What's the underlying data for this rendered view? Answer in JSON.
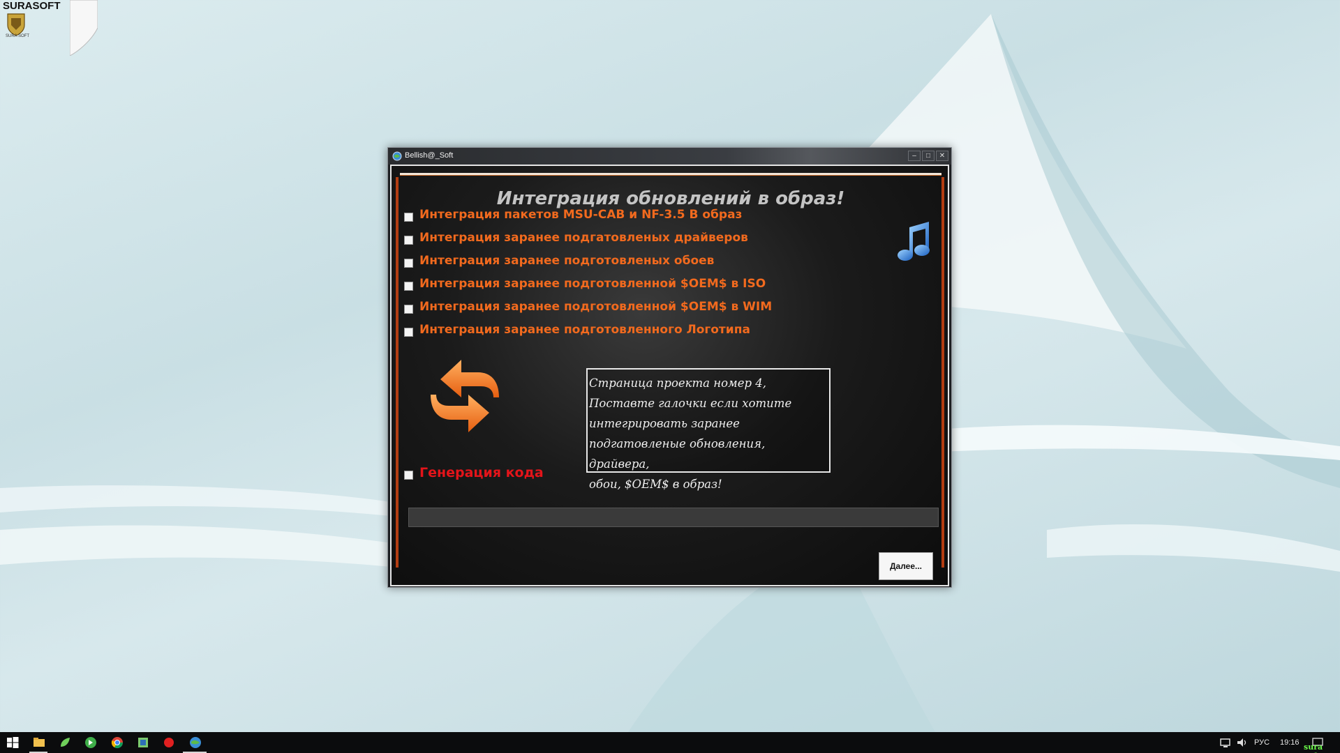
{
  "desktop": {
    "corner_brand": "SURASOFT",
    "corner_crest_caption": "SURA SOFT"
  },
  "window": {
    "title": "Bellish@_Soft",
    "controls": {
      "minimize": "–",
      "maximize": "□",
      "close": "✕"
    }
  },
  "content": {
    "heading": "Интеграция обновлений в образ!",
    "options": [
      {
        "label": "Интеграция пакетов MSU-CAB  и NF-3.5 В образ",
        "checked": false
      },
      {
        "label": "Интеграция заранее подгатовленых драйверов",
        "checked": false
      },
      {
        "label": "Интеграция заранее подготовленых обоев",
        "checked": false
      },
      {
        "label": "Интеграция заранее подготовленной $OEM$ в ISO",
        "checked": false
      },
      {
        "label": "Интеграция заранее подготовленной $OEM$ в WIM",
        "checked": false
      },
      {
        "label": "Интеграция заранее подготовленного Логотипа",
        "checked": false
      }
    ],
    "info_lines": [
      " Страница проекта номер 4,",
      "Поставте галочки если хотите",
      "интегрировать заранее",
      "подгатовленые обновления, драйвера,",
      "обои, $OEM$ в образ!"
    ],
    "generate_code_label": "Генерация кода",
    "progress_percent": 0,
    "next_button": "Далее..."
  },
  "icons": {
    "music": "music-note-icon",
    "sync": "sync-arrows-icon"
  },
  "taskbar": {
    "language": "РУС",
    "time": "19:16",
    "brand": "sura soft"
  },
  "colors": {
    "option_text": "#f26a1e",
    "generate_text": "#e4141a",
    "accent_bar": "#b33d12"
  }
}
